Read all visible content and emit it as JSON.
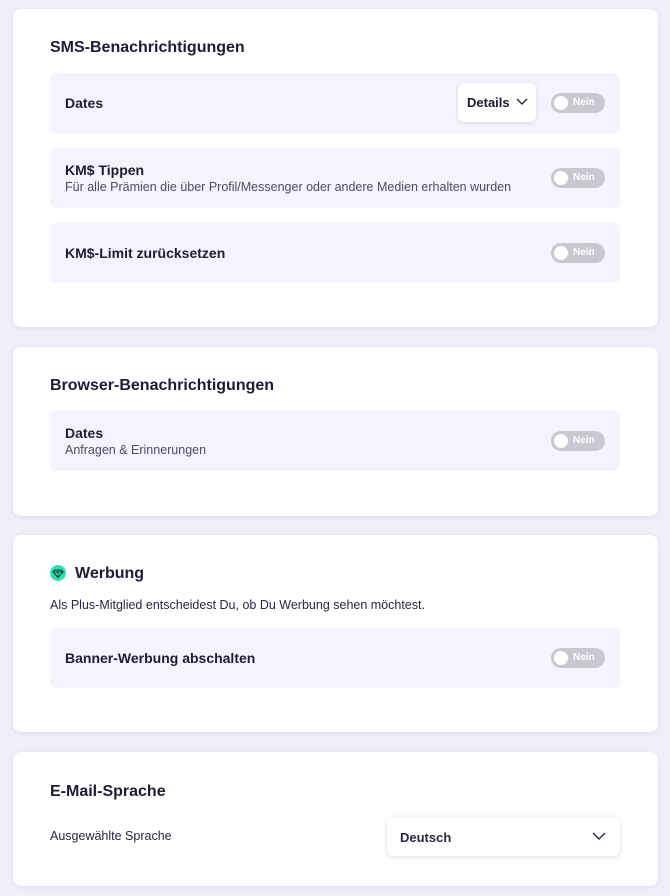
{
  "sms": {
    "title": "SMS-Benachrichtigungen",
    "rows": [
      {
        "label": "Dates",
        "details_label": "Details",
        "toggle": "Nein"
      },
      {
        "label": "KM$ Tippen",
        "sub": "Für alle Prämien die über Profil/Messenger oder andere Medien erhalten wurden",
        "toggle": "Nein"
      },
      {
        "label": "KM$-Limit zurücksetzen",
        "toggle": "Nein"
      }
    ]
  },
  "browser": {
    "title": "Browser-Benachrichtigungen",
    "rows": [
      {
        "label": "Dates",
        "sub": "Anfragen & Erinnerungen",
        "toggle": "Nein"
      }
    ]
  },
  "werbung": {
    "title": "Werbung",
    "icon": "plus-member-diamond-icon",
    "icon_color": "#2fe0b4",
    "description": "Als Plus-Mitglied entscheidest Du, ob Du Werbung sehen möchtest.",
    "rows": [
      {
        "label": "Banner-Werbung abschalten",
        "toggle": "Nein"
      }
    ]
  },
  "email_language": {
    "title": "E-Mail-Sprache",
    "label": "Ausgewählte Sprache",
    "selected": "Deutsch"
  },
  "colors": {
    "background": "#f1eef9",
    "card": "#ffffff",
    "row": "#f5f3ff",
    "toggle_off": "#c9c7d0",
    "text": "#1f1b33"
  }
}
